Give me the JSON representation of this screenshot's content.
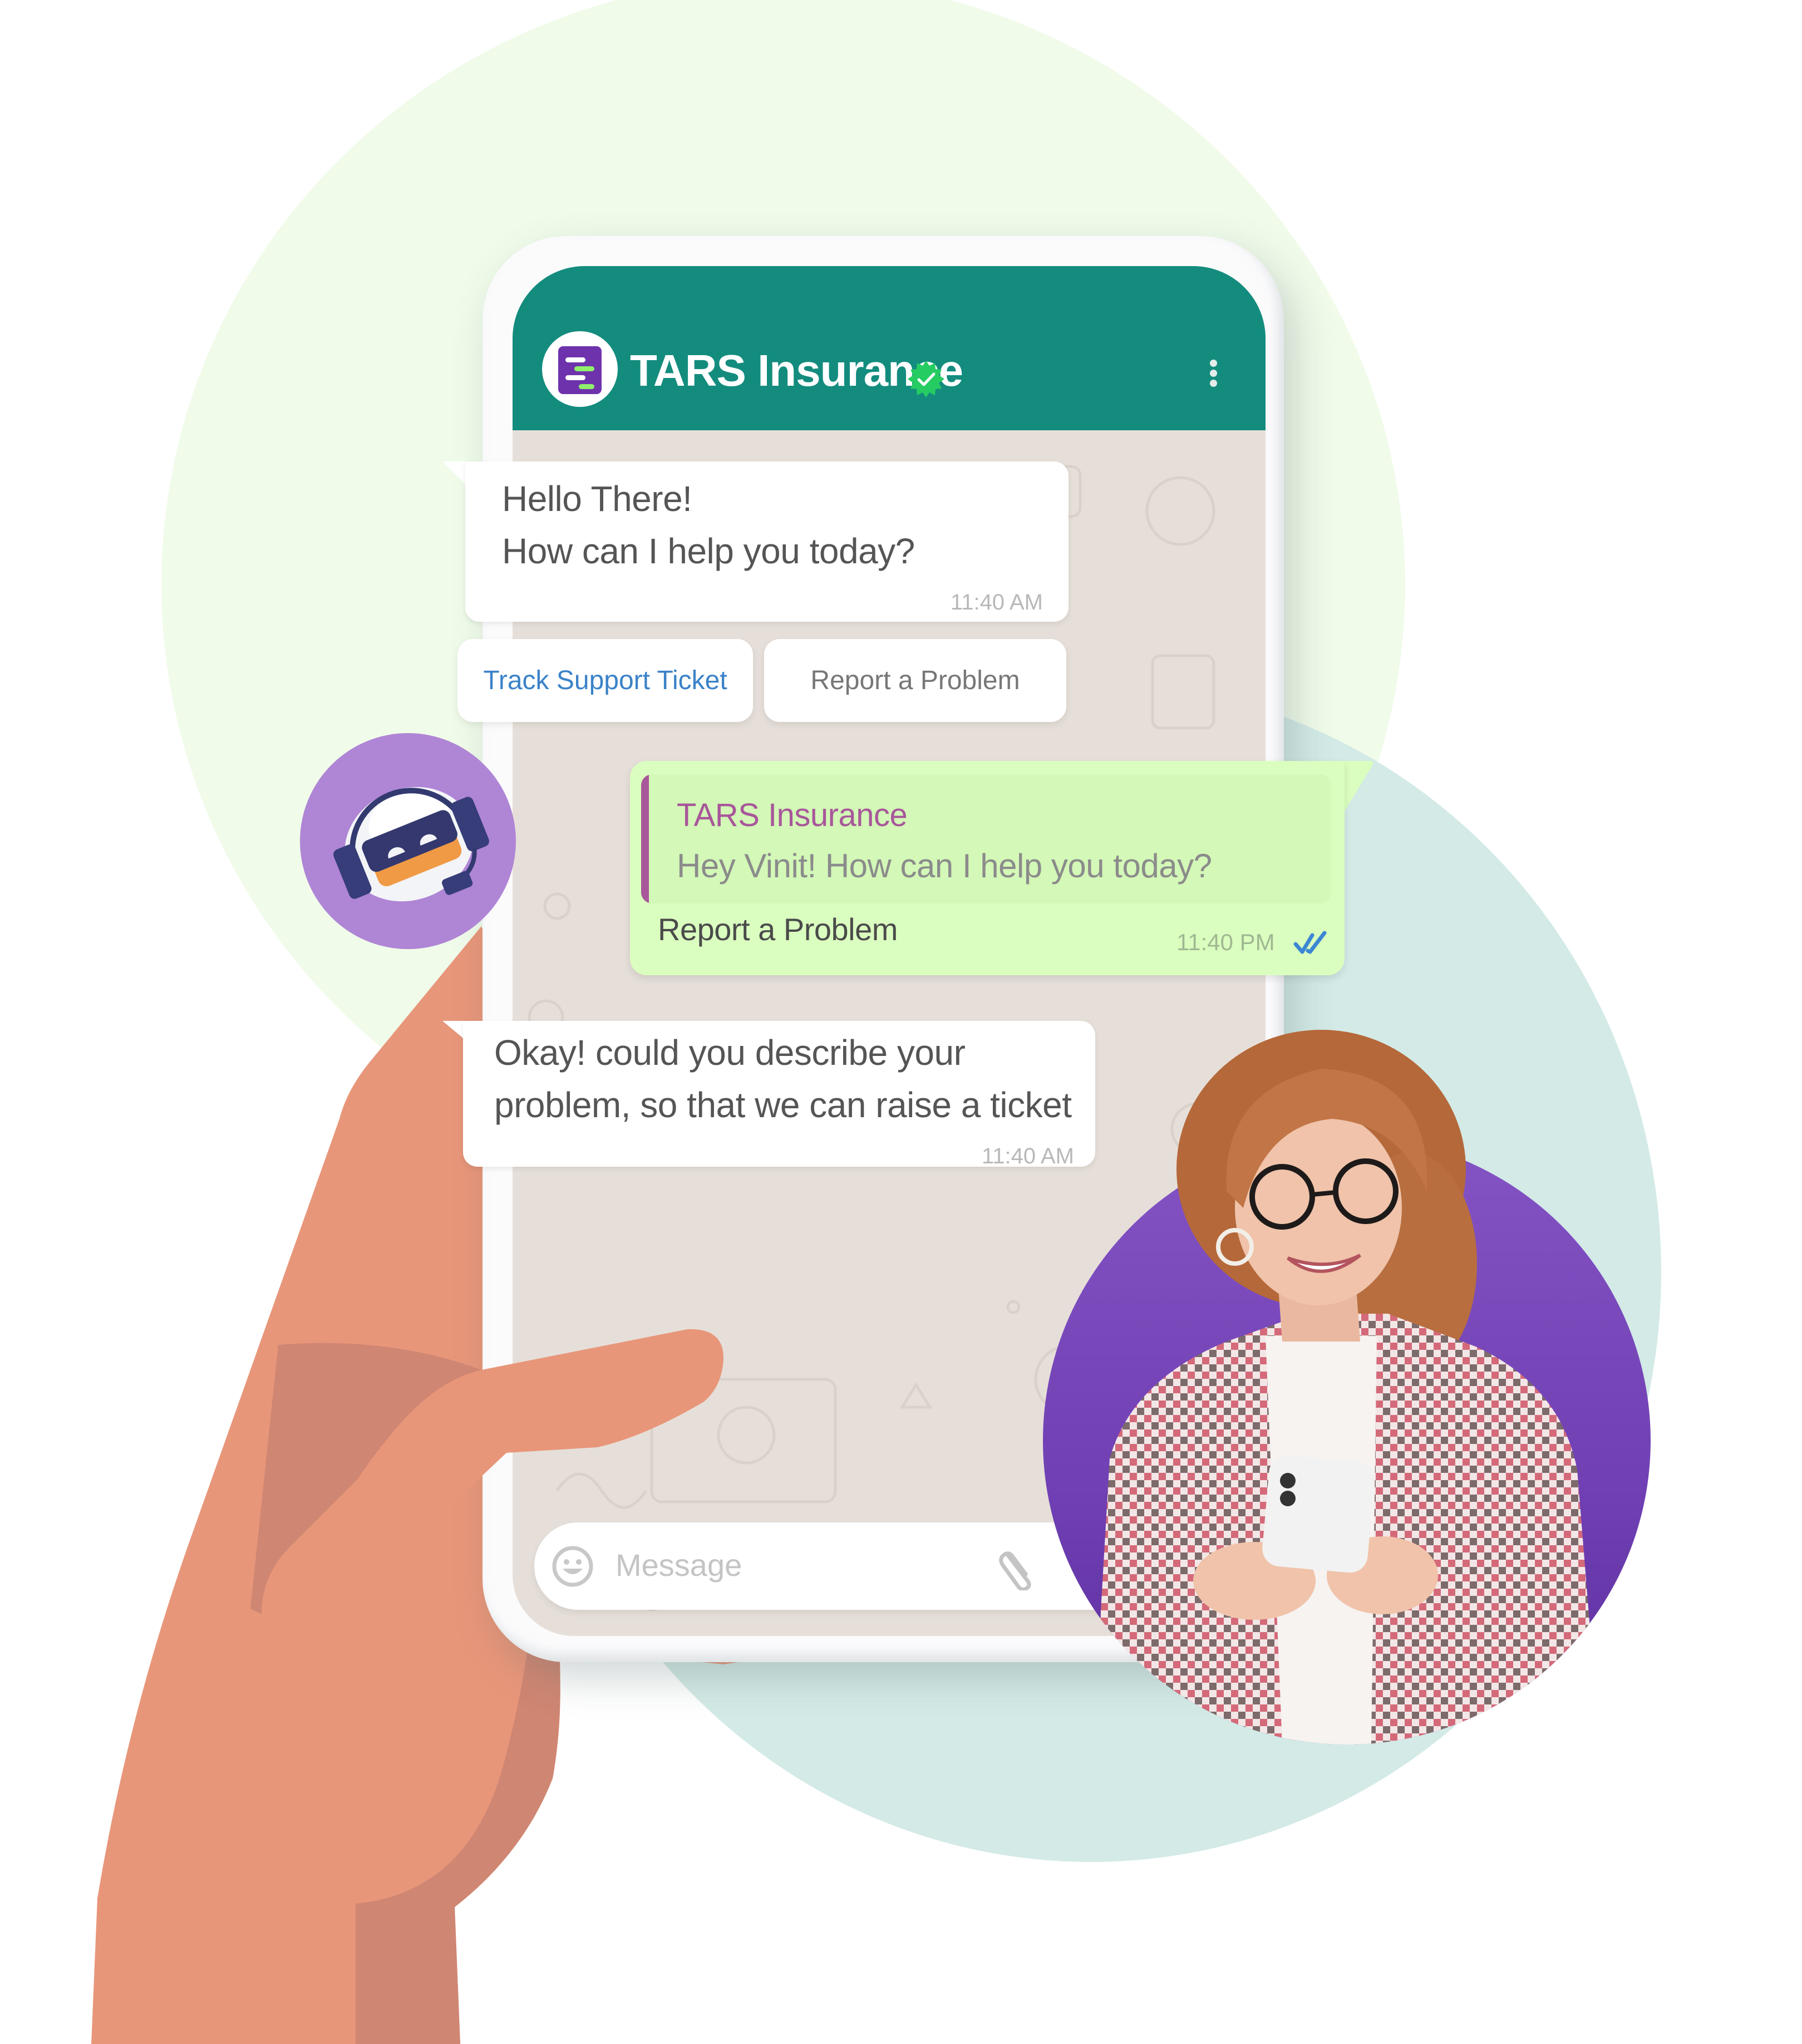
{
  "app": {
    "contact_name": "TARS Insurance",
    "verified": true,
    "header_color": "#138c7e",
    "logo_color": "#6e33ac",
    "logo_accent": "#8ff06b"
  },
  "messages": [
    {
      "direction": "incoming",
      "lines": [
        "Hello There!",
        "How can I help you today?"
      ],
      "time": "11:40 AM"
    },
    {
      "direction": "outgoing",
      "quoted": {
        "sender": "TARS Insurance",
        "text": "Hey Vinit! How can I help you today?"
      },
      "text": "Report a Problem",
      "time": "11:40 PM",
      "status": "read"
    },
    {
      "direction": "incoming",
      "lines": [
        "Okay! could you describe your",
        "problem, so that we can raise a ticket"
      ],
      "time": "11:40 AM"
    }
  ],
  "quick_replies": [
    {
      "label": "Track Support Ticket",
      "color": "#3b82c8"
    },
    {
      "label": "Report a Problem",
      "color": "#777777"
    }
  ],
  "composer": {
    "placeholder": "Message",
    "left_icon": "emoji-icon",
    "right_icon": "attach-icon"
  },
  "illustrations": {
    "bot_avatar": "robot-headset-avatar",
    "customer_photo": "woman-with-phone",
    "hand": "hand-holding-phone"
  },
  "colors": {
    "incoming_bubble": "#ffffff",
    "outgoing_bubble": "#dafebf",
    "quote_accent": "#a8579a",
    "read_ticks": "#3c87d4",
    "chat_background": "#e6dfd9",
    "bot_circle": "#af85d5",
    "customer_circle": "#7a4cc0",
    "bg_blob_green": "#f0fbea",
    "bg_blob_teal": "#d3eae6",
    "skin": "#e8967a",
    "skin_shadow": "#cf8672"
  }
}
